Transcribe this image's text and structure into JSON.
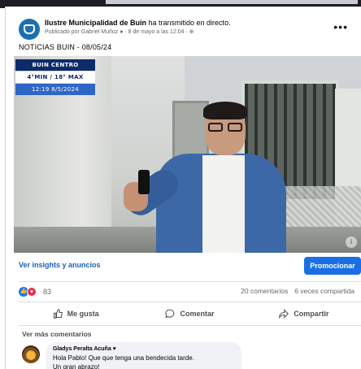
{
  "post": {
    "page_name": "Ilustre Municipalidad de Buin",
    "action_text": " ha transmitido en directo.",
    "meta": "Publicado por Gabriel Muñoz ● · 8 de mayo a las 12:04 · ⊕",
    "title": "NOTICIAS BUIN - 08/05/24",
    "more_icon": "•••"
  },
  "overlay": {
    "station": "BUIN CENTRO",
    "temp": "4°MIN / 18° MAX",
    "time": "12:19  8/5/2024"
  },
  "insights": {
    "link": "Ver insights y anuncios",
    "promote": "Promocionar"
  },
  "stats": {
    "reaction_count": "83",
    "comments": "20 comentarios",
    "shares": "6 veces compartida"
  },
  "actions": {
    "like": "Me gusta",
    "comment": "Comentar",
    "share": "Compartir"
  },
  "comments": {
    "more": "Ver más comentarios",
    "items": [
      {
        "author": "Gladys Peralta Acuña ♥",
        "line1": "Hola Pablo! Que que tenga una bendecida tarde.",
        "line2": "Un gran abrazo!"
      }
    ]
  },
  "colors": {
    "accent": "#1b6fe4",
    "link": "#1b5fbf",
    "like": "#1877f2",
    "love": "#f02849"
  }
}
